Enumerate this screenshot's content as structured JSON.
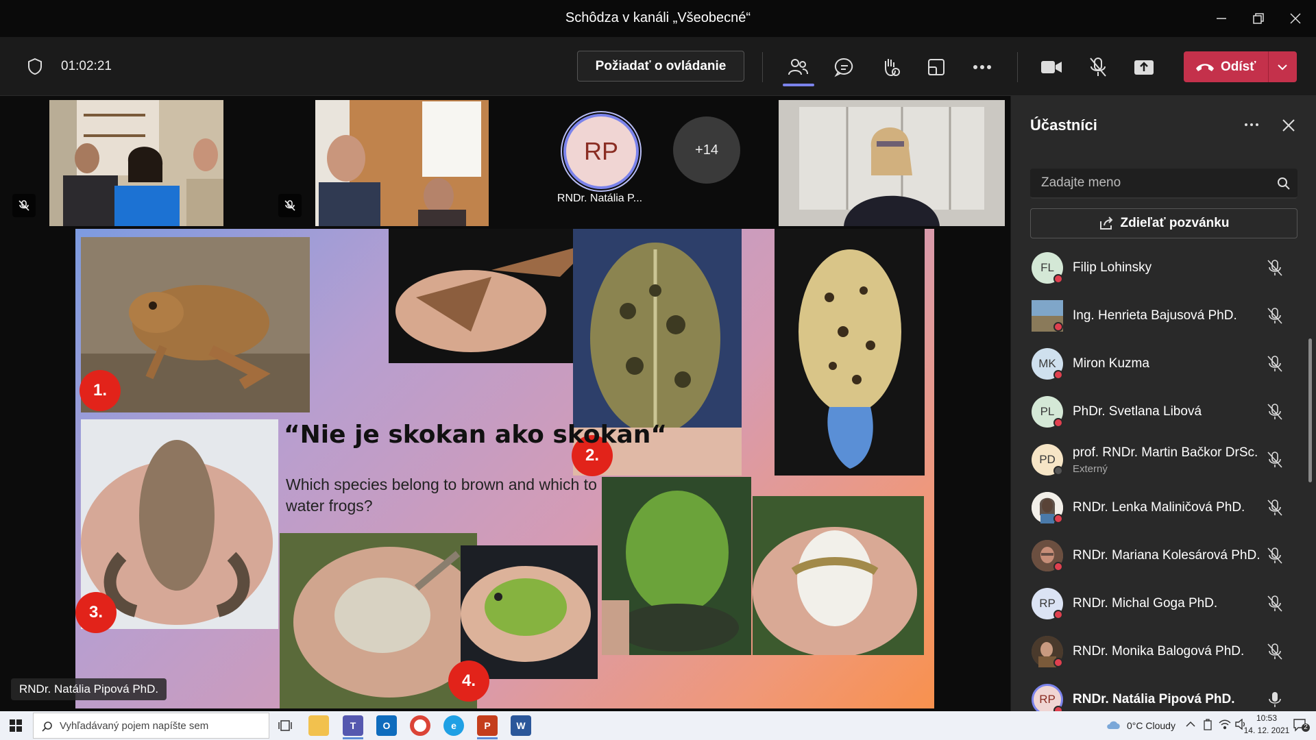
{
  "window": {
    "title": "Schôdza v kanáli „Všeobecné“"
  },
  "toolbar": {
    "timer": "01:02:21",
    "request_control_label": "Požiadať o ovládanie",
    "leave_label": "Odísť"
  },
  "stage": {
    "avatar_initials": "RP",
    "avatar_name": "RNDr. Natália P...",
    "overflow_count": "+14",
    "speaker_name": "RNDr. Natália Pipová PhD."
  },
  "slide": {
    "title": "“Nie je skokan ako skokan“",
    "text": "Which species belong to brown and which to water frogs?",
    "badges": [
      "1.",
      "2.",
      "3.",
      "4."
    ]
  },
  "panel": {
    "title": "Účastníci",
    "search_placeholder": "Zadajte meno",
    "invite_label": "Zdieľať pozvánku",
    "participants": [
      {
        "initials": "FL",
        "name": "Filip Lohinsky",
        "subtitle": "",
        "avatar_color": "#d4e8d6",
        "mic": "muted"
      },
      {
        "initials": "",
        "name": "Ing. Henrieta Bajusová PhD.",
        "subtitle": "",
        "avatar_color": "#7a8c9e",
        "mic": "muted"
      },
      {
        "initials": "MK",
        "name": "Miron Kuzma",
        "subtitle": "",
        "avatar_color": "#cfe0ee",
        "mic": "muted"
      },
      {
        "initials": "PL",
        "name": "PhDr. Svetlana Libová",
        "subtitle": "",
        "avatar_color": "#d4e8d6",
        "mic": "muted"
      },
      {
        "initials": "PD",
        "name": "prof. RNDr. Martin Bačkor DrSc.",
        "subtitle": "Externý",
        "avatar_color": "#f6e5c6",
        "mic": "muted"
      },
      {
        "initials": "",
        "name": "RNDr. Lenka Maliničová PhD.",
        "subtitle": "",
        "avatar_color": "#e8e2dc",
        "mic": "muted"
      },
      {
        "initials": "",
        "name": "RNDr. Mariana Kolesárová PhD.",
        "subtitle": "",
        "avatar_color": "#8b6a5a",
        "mic": "muted"
      },
      {
        "initials": "RP",
        "name": "RNDr. Michal Goga PhD.",
        "subtitle": "",
        "avatar_color": "#dbe3f4",
        "mic": "muted"
      },
      {
        "initials": "",
        "name": "RNDr. Monika Balogová PhD.",
        "subtitle": "",
        "avatar_color": "#6e5a4a",
        "mic": "muted"
      },
      {
        "initials": "RP",
        "name": "RNDr. Natália Pipová PhD.",
        "subtitle": "",
        "avatar_color": "#f0d5d3",
        "mic": "on"
      }
    ]
  },
  "taskbar": {
    "search_placeholder": "Vyhľadávaný pojem napíšte sem",
    "weather": "0°C  Cloudy",
    "time": "10:53",
    "date": "14. 12. 2021",
    "notification_count": "2"
  },
  "colors": {
    "accent": "#7b83eb",
    "leave": "#c4314b",
    "badge_red": "#e2231a"
  }
}
